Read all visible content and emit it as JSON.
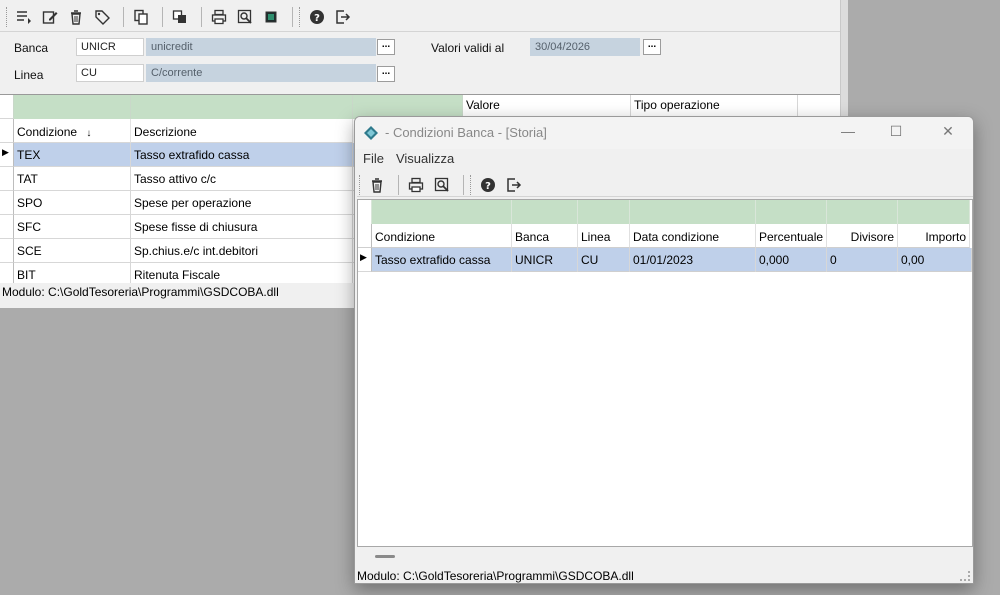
{
  "main": {
    "form": {
      "banca_label": "Banca",
      "banca_code": "UNICR",
      "banca_name": "unicredit",
      "linea_label": "Linea",
      "linea_code": "CU",
      "linea_name": "C/corrente",
      "valori_label": "Valori validi al",
      "valori_date": "30/04/2026",
      "browse_label": "..."
    },
    "grid": {
      "group_headers": [
        "",
        "",
        "",
        "Valore",
        "Tipo operazione"
      ],
      "columns": [
        "Condizione",
        "Descrizione"
      ],
      "sort_indicator": "↓",
      "rows": [
        {
          "condizione": "TEX",
          "descrizione": "Tasso extrafido cassa"
        },
        {
          "condizione": "TAT",
          "descrizione": "Tasso attivo c/c"
        },
        {
          "condizione": "SPO",
          "descrizione": "Spese per operazione"
        },
        {
          "condizione": "SFC",
          "descrizione": "Spese fisse di chiusura"
        },
        {
          "condizione": "SCE",
          "descrizione": "Sp.chius.e/c int.debitori"
        },
        {
          "condizione": "BIT",
          "descrizione": "Ritenuta Fiscale"
        }
      ],
      "current_row_marker": "▶"
    },
    "status": "Modulo: C:\\GoldTesoreria\\Programmi\\GSDCOBA.dll"
  },
  "dialog": {
    "title": "- Condizioni Banca - [Storia]",
    "controls": {
      "minimize": "—",
      "maximize": "☐",
      "close": "✕"
    },
    "menu": [
      "File",
      "Visualizza"
    ],
    "grid": {
      "columns": [
        "Condizione",
        "Banca",
        "Linea",
        "Data condizione",
        "Percentuale",
        "Divisore",
        "Importo"
      ],
      "rows": [
        {
          "condizione": "Tasso extrafido cassa",
          "banca": "UNICR",
          "linea": "CU",
          "data": "01/01/2023",
          "percentuale": "0,000",
          "divisore": "0",
          "importo": "0,00"
        }
      ],
      "current_row_marker": "▶"
    },
    "status": "Modulo: C:\\GoldTesoreria\\Programmi\\GSDCOBA.dll"
  },
  "colors": {
    "grid_group_header": "#c5dfc6",
    "selected_row": "#bfd0ea",
    "readonly_field": "#c6d3df",
    "desktop": "#ababab"
  }
}
